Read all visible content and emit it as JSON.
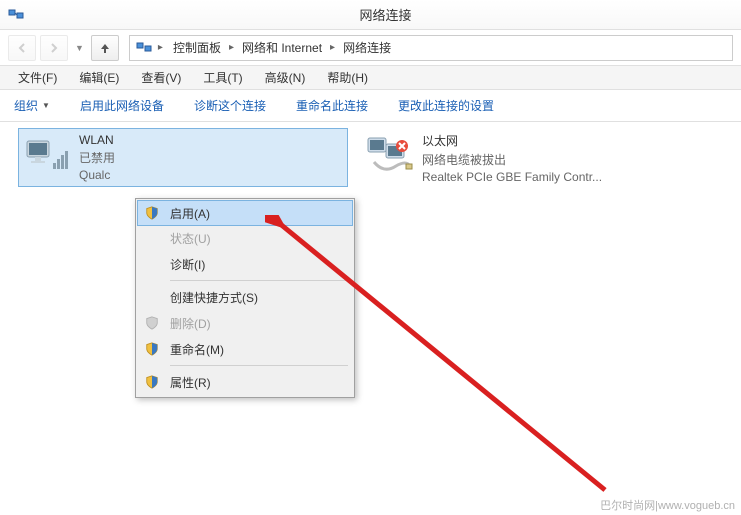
{
  "window": {
    "title": "网络连接"
  },
  "breadcrumb": {
    "root": "控制面板",
    "mid": "网络和 Internet",
    "leaf": "网络连接"
  },
  "menubar": {
    "file": "文件(F)",
    "edit": "编辑(E)",
    "view": "查看(V)",
    "tools": "工具(T)",
    "advanced": "高级(N)",
    "help": "帮助(H)"
  },
  "toolbar": {
    "organize": "组织",
    "enable": "启用此网络设备",
    "diagnose": "诊断这个连接",
    "rename": "重命名此连接",
    "change": "更改此连接的设置"
  },
  "adapters": {
    "wlan": {
      "name": "WLAN",
      "status": "已禁用",
      "detail": "Qualc"
    },
    "ether": {
      "name": "以太网",
      "status": "网络电缆被拔出",
      "detail": "Realtek PCIe GBE Family Contr..."
    }
  },
  "context_menu": {
    "enable": "启用(A)",
    "status": "状态(U)",
    "diagnose": "诊断(I)",
    "shortcut": "创建快捷方式(S)",
    "delete": "删除(D)",
    "rename": "重命名(M)",
    "properties": "属性(R)"
  },
  "watermark": "巴尔时尚网|www.vogueb.cn"
}
